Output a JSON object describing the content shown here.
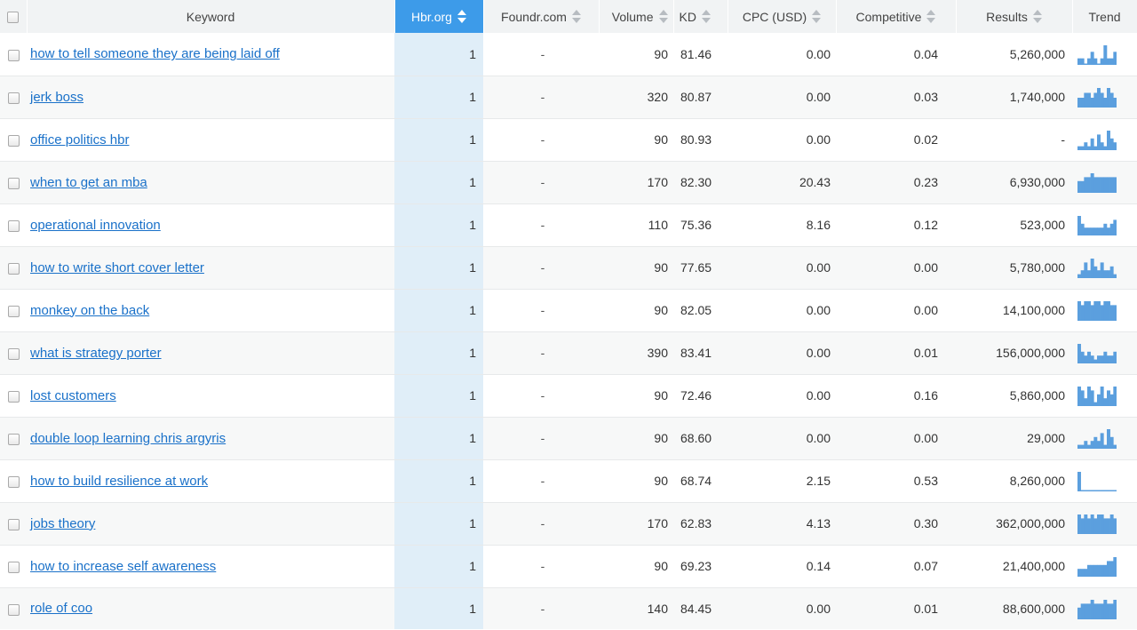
{
  "header": {
    "keyword": "Keyword",
    "hbr": "Hbr.org",
    "foundr": "Foundr.com",
    "volume": "Volume",
    "kd": "KD",
    "cpc": "CPC (USD)",
    "competitive": "Competitive",
    "results": "Results",
    "trend": "Trend"
  },
  "colors": {
    "active_header": "#3d9be9",
    "highlight_column": "#e0eef8",
    "link": "#1a71c9",
    "trend": "#5b9fde"
  },
  "rows": [
    {
      "keyword": "how to tell someone they are being laid off",
      "hbr": "1",
      "foundr": "-",
      "volume": "90",
      "kd": "81.46",
      "cpc": "0.00",
      "competitive": "0.04",
      "results": "5,260,000",
      "trend": [
        1,
        1,
        0,
        1,
        2,
        1,
        0,
        1,
        3,
        1,
        1,
        2
      ]
    },
    {
      "keyword": "jerk boss",
      "hbr": "1",
      "foundr": "-",
      "volume": "320",
      "kd": "80.87",
      "cpc": "0.00",
      "competitive": "0.03",
      "results": "1,740,000",
      "trend": [
        2,
        2,
        3,
        3,
        2,
        3,
        4,
        3,
        2,
        4,
        3,
        2
      ]
    },
    {
      "keyword": "office politics hbr",
      "hbr": "1",
      "foundr": "-",
      "volume": "90",
      "kd": "80.93",
      "cpc": "0.00",
      "competitive": "0.02",
      "results": "-",
      "trend": [
        1,
        1,
        2,
        1,
        3,
        1,
        4,
        2,
        1,
        5,
        3,
        2
      ]
    },
    {
      "keyword": "when to get an mba",
      "hbr": "1",
      "foundr": "-",
      "volume": "170",
      "kd": "82.30",
      "cpc": "20.43",
      "competitive": "0.23",
      "results": "6,930,000",
      "trend": [
        3,
        3,
        4,
        4,
        5,
        4,
        4,
        4,
        4,
        4,
        4,
        4
      ]
    },
    {
      "keyword": "operational innovation",
      "hbr": "1",
      "foundr": "-",
      "volume": "110",
      "kd": "75.36",
      "cpc": "8.16",
      "competitive": "0.12",
      "results": "523,000",
      "trend": [
        5,
        3,
        2,
        2,
        2,
        2,
        2,
        2,
        3,
        2,
        3,
        4
      ]
    },
    {
      "keyword": "how to write short cover letter",
      "hbr": "1",
      "foundr": "-",
      "volume": "90",
      "kd": "77.65",
      "cpc": "0.00",
      "competitive": "0.00",
      "results": "5,780,000",
      "trend": [
        1,
        2,
        4,
        2,
        5,
        3,
        2,
        4,
        2,
        2,
        3,
        1
      ]
    },
    {
      "keyword": "monkey on the back",
      "hbr": "1",
      "foundr": "-",
      "volume": "90",
      "kd": "82.05",
      "cpc": "0.00",
      "competitive": "0.00",
      "results": "14,100,000",
      "trend": [
        5,
        4,
        5,
        5,
        4,
        5,
        5,
        4,
        5,
        5,
        4,
        4
      ]
    },
    {
      "keyword": "what is strategy porter",
      "hbr": "1",
      "foundr": "-",
      "volume": "390",
      "kd": "83.41",
      "cpc": "0.00",
      "competitive": "0.01",
      "results": "156,000,000",
      "trend": [
        5,
        3,
        2,
        3,
        2,
        1,
        2,
        2,
        3,
        2,
        2,
        3
      ]
    },
    {
      "keyword": "lost customers",
      "hbr": "1",
      "foundr": "-",
      "volume": "90",
      "kd": "72.46",
      "cpc": "0.00",
      "competitive": "0.16",
      "results": "5,860,000",
      "trend": [
        5,
        4,
        2,
        5,
        4,
        1,
        3,
        5,
        2,
        4,
        3,
        5
      ]
    },
    {
      "keyword": "double loop learning chris argyris",
      "hbr": "1",
      "foundr": "-",
      "volume": "90",
      "kd": "68.60",
      "cpc": "0.00",
      "competitive": "0.00",
      "results": "29,000",
      "trend": [
        1,
        1,
        2,
        1,
        2,
        3,
        2,
        4,
        1,
        5,
        3,
        1
      ]
    },
    {
      "keyword": "how to build resilience at work",
      "hbr": "1",
      "foundr": "-",
      "volume": "90",
      "kd": "68.74",
      "cpc": "2.15",
      "competitive": "0.53",
      "results": "8,260,000",
      "trend": [
        6,
        0,
        0,
        0,
        0,
        0,
        0,
        0,
        0,
        0,
        0,
        0
      ]
    },
    {
      "keyword": "jobs theory",
      "hbr": "1",
      "foundr": "-",
      "volume": "170",
      "kd": "62.83",
      "cpc": "4.13",
      "competitive": "0.30",
      "results": "362,000,000",
      "trend": [
        5,
        4,
        5,
        4,
        5,
        4,
        5,
        5,
        4,
        4,
        5,
        4
      ]
    },
    {
      "keyword": "how to increase self awareness",
      "hbr": "1",
      "foundr": "-",
      "volume": "90",
      "kd": "69.23",
      "cpc": "0.14",
      "competitive": "0.07",
      "results": "21,400,000",
      "trend": [
        2,
        2,
        2,
        3,
        3,
        3,
        3,
        3,
        3,
        4,
        4,
        5
      ]
    },
    {
      "keyword": "role of coo",
      "hbr": "1",
      "foundr": "-",
      "volume": "140",
      "kd": "84.45",
      "cpc": "0.00",
      "competitive": "0.01",
      "results": "88,600,000",
      "trend": [
        3,
        4,
        4,
        4,
        5,
        4,
        4,
        4,
        5,
        4,
        4,
        5
      ]
    }
  ]
}
